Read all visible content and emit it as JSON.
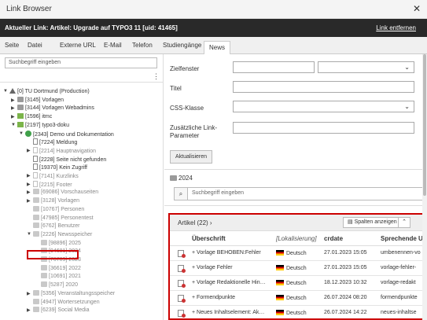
{
  "window": {
    "title": "Link Browser",
    "close_icon": "close-icon"
  },
  "linkbar": {
    "current": "Aktueller Link: Artikel: Upgrade auf TYPO3 11 [uid: 41465]",
    "remove": "Link entfernen"
  },
  "tabs": [
    "Seite",
    "Datei",
    "Externe URL",
    "E-Mail",
    "Telefon",
    "Studiengänge",
    "News"
  ],
  "active_tab": "News",
  "tree": {
    "search_placeholder": "Suchbegriff eingeben",
    "items": [
      {
        "label": "[0] TU Dortmund (Production)",
        "icon": "root-icon",
        "caret": "▼",
        "gray": false
      },
      {
        "label": "[3145] Vorlagen",
        "icon": "folder-icon",
        "caret": "▶",
        "gray": false
      },
      {
        "label": "[3144] Vorlagen Webadmins",
        "icon": "folder-icon",
        "caret": "▶",
        "gray": false
      },
      {
        "label": "[1596] itmc",
        "icon": "lock-icon",
        "caret": "▶",
        "gray": false
      },
      {
        "label": "[2197] typo3-doku",
        "icon": "lock-icon",
        "caret": "▼",
        "gray": false
      },
      {
        "label": "[2343] Demo und Dokumentation",
        "icon": "globe-icon",
        "caret": "▼",
        "gray": false
      },
      {
        "label": "[7224] Meldung",
        "icon": "page-icon",
        "caret": "",
        "gray": false
      },
      {
        "label": "[2214] Hauptnavigation",
        "icon": "page-icon",
        "caret": "▶",
        "gray": true
      },
      {
        "label": "[2228] Seite nicht gefunden",
        "icon": "page-icon",
        "caret": "",
        "gray": false
      },
      {
        "label": "[19370] Kein Zugriff",
        "icon": "page-icon",
        "caret": "",
        "gray": false
      },
      {
        "label": "[7141] Kurzlinks",
        "icon": "page-icon",
        "caret": "▶",
        "gray": true
      },
      {
        "label": "[2215] Footer",
        "icon": "page-icon",
        "caret": "▶",
        "gray": true
      },
      {
        "label": "[69086] Vorschauseiten",
        "icon": "folder-icon",
        "caret": "▶",
        "gray": true
      },
      {
        "label": "[3128] Vorlagen",
        "icon": "folder-icon",
        "caret": "▶",
        "gray": true
      },
      {
        "label": "[10767] Personen",
        "icon": "folder-icon",
        "caret": "",
        "gray": true
      },
      {
        "label": "[47985] Personentest",
        "icon": "folder-icon",
        "caret": "",
        "gray": true
      },
      {
        "label": "[6762] Benutzer",
        "icon": "folder-icon",
        "caret": "",
        "gray": true
      },
      {
        "label": "[2226] Newsspeicher",
        "icon": "folder-icon",
        "caret": "▼",
        "gray": true
      },
      {
        "label": "[98896] 2025",
        "icon": "folder-icon",
        "caret": "",
        "gray": true
      },
      {
        "label": "[94681] 2024",
        "icon": "folder-icon",
        "caret": "",
        "gray": true
      },
      {
        "label": "[76709] 2023",
        "icon": "folder-icon",
        "caret": "",
        "gray": true
      },
      {
        "label": "[36619] 2022",
        "icon": "folder-icon",
        "caret": "",
        "gray": true
      },
      {
        "label": "[10691] 2021",
        "icon": "folder-icon",
        "caret": "",
        "gray": true
      },
      {
        "label": "[5287] 2020",
        "icon": "folder-icon",
        "caret": "",
        "gray": true
      },
      {
        "label": "[5356] Veranstaltungsspeicher",
        "icon": "folder-icon",
        "caret": "▶",
        "gray": true
      },
      {
        "label": "[4947] Wortersetzungen",
        "icon": "folder-icon",
        "caret": "",
        "gray": true
      },
      {
        "label": "[6239] Social Media",
        "icon": "folder-icon",
        "caret": "▶",
        "gray": true
      }
    ]
  },
  "form": {
    "zielfenster_label": "Zielfenster",
    "titel_label": "Titel",
    "css_label": "CSS-Klasse",
    "zusatz_label_1": "Zusätzliche Link-",
    "zusatz_label_2": "Parameter",
    "update_button": "Aktualisieren"
  },
  "folder_label": "2024",
  "search_right_placeholder": "Suchbegriff eingeben",
  "list": {
    "title": "Artikel (22)",
    "columns_button": "Spalten anzeigen",
    "headers": [
      "Überschrift",
      "[Lokalisierung]",
      "crdate",
      "Sprechende U"
    ],
    "rows": [
      {
        "title": "Vorlage BEHOBEN:Fehler",
        "lang": "Deutsch",
        "date": "27.01.2023 15:05",
        "slug": "umbenennen-vo"
      },
      {
        "title": "Vorlage Fehler",
        "lang": "Deutsch",
        "date": "27.01.2023 15:05",
        "slug": "vorlage-fehler-"
      },
      {
        "title": "Vorlage Redaktionelle Hin…",
        "lang": "Deutsch",
        "date": "18.12.2023 10:32",
        "slug": "vorlage-redakt"
      },
      {
        "title": "Formendpunkte",
        "lang": "Deutsch",
        "date": "26.07.2024 08:20",
        "slug": "formendpunkte"
      },
      {
        "title": "Neues Inhaltselement: Ak…",
        "lang": "Deutsch",
        "date": "26.07.2024 14:22",
        "slug": "neues-inhaltse"
      }
    ]
  }
}
